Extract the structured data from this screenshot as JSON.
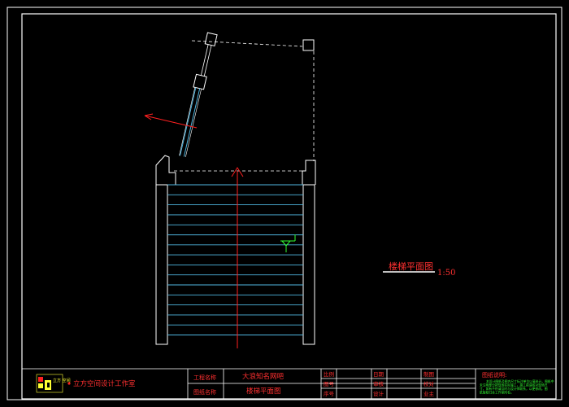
{
  "drawing": {
    "title": "楼梯平面图",
    "scale": "1:50"
  },
  "title_block": {
    "company": "立方空间设计工作室",
    "logo_text": "立方 空间",
    "project_label": "工程名称",
    "project_value": "大浪知名网吧",
    "drawing_label": "图纸名称",
    "drawing_value": "楼梯平面图",
    "grid_labels": [
      "比例",
      "图号",
      "序号",
      "日期",
      "审核",
      "设计",
      "制图",
      "校对",
      "业主"
    ],
    "notes_title": "图纸说明:",
    "notes_text": "本设计图纸及图内尺寸标注单位以毫米计。图纸中未注明部分按现场实际施工，施工前请核对现场尺寸，如有不符请及时与设计师联系，以便修改。图纸版权归本工作室所有。"
  },
  "colors": {
    "line_white": "#ffffff",
    "tread_cyan": "#4fb6e0",
    "accent_red": "#ff2020",
    "text_red": "#ff3030",
    "text_green": "#33ff33",
    "text_yellow": "#ffff33",
    "bg": "#000000"
  }
}
